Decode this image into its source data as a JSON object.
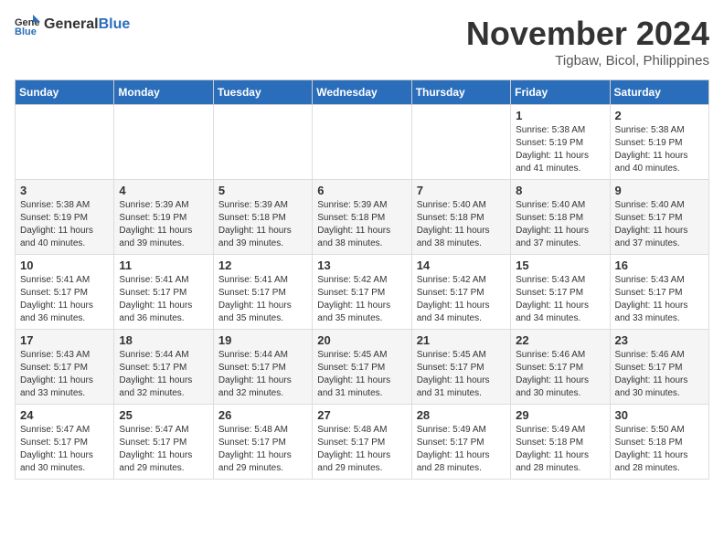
{
  "header": {
    "logo_general": "General",
    "logo_blue": "Blue",
    "month": "November 2024",
    "location": "Tigbaw, Bicol, Philippines"
  },
  "weekdays": [
    "Sunday",
    "Monday",
    "Tuesday",
    "Wednesday",
    "Thursday",
    "Friday",
    "Saturday"
  ],
  "weeks": [
    [
      {
        "day": "",
        "info": ""
      },
      {
        "day": "",
        "info": ""
      },
      {
        "day": "",
        "info": ""
      },
      {
        "day": "",
        "info": ""
      },
      {
        "day": "",
        "info": ""
      },
      {
        "day": "1",
        "info": "Sunrise: 5:38 AM\nSunset: 5:19 PM\nDaylight: 11 hours\nand 41 minutes."
      },
      {
        "day": "2",
        "info": "Sunrise: 5:38 AM\nSunset: 5:19 PM\nDaylight: 11 hours\nand 40 minutes."
      }
    ],
    [
      {
        "day": "3",
        "info": "Sunrise: 5:38 AM\nSunset: 5:19 PM\nDaylight: 11 hours\nand 40 minutes."
      },
      {
        "day": "4",
        "info": "Sunrise: 5:39 AM\nSunset: 5:19 PM\nDaylight: 11 hours\nand 39 minutes."
      },
      {
        "day": "5",
        "info": "Sunrise: 5:39 AM\nSunset: 5:18 PM\nDaylight: 11 hours\nand 39 minutes."
      },
      {
        "day": "6",
        "info": "Sunrise: 5:39 AM\nSunset: 5:18 PM\nDaylight: 11 hours\nand 38 minutes."
      },
      {
        "day": "7",
        "info": "Sunrise: 5:40 AM\nSunset: 5:18 PM\nDaylight: 11 hours\nand 38 minutes."
      },
      {
        "day": "8",
        "info": "Sunrise: 5:40 AM\nSunset: 5:18 PM\nDaylight: 11 hours\nand 37 minutes."
      },
      {
        "day": "9",
        "info": "Sunrise: 5:40 AM\nSunset: 5:17 PM\nDaylight: 11 hours\nand 37 minutes."
      }
    ],
    [
      {
        "day": "10",
        "info": "Sunrise: 5:41 AM\nSunset: 5:17 PM\nDaylight: 11 hours\nand 36 minutes."
      },
      {
        "day": "11",
        "info": "Sunrise: 5:41 AM\nSunset: 5:17 PM\nDaylight: 11 hours\nand 36 minutes."
      },
      {
        "day": "12",
        "info": "Sunrise: 5:41 AM\nSunset: 5:17 PM\nDaylight: 11 hours\nand 35 minutes."
      },
      {
        "day": "13",
        "info": "Sunrise: 5:42 AM\nSunset: 5:17 PM\nDaylight: 11 hours\nand 35 minutes."
      },
      {
        "day": "14",
        "info": "Sunrise: 5:42 AM\nSunset: 5:17 PM\nDaylight: 11 hours\nand 34 minutes."
      },
      {
        "day": "15",
        "info": "Sunrise: 5:43 AM\nSunset: 5:17 PM\nDaylight: 11 hours\nand 34 minutes."
      },
      {
        "day": "16",
        "info": "Sunrise: 5:43 AM\nSunset: 5:17 PM\nDaylight: 11 hours\nand 33 minutes."
      }
    ],
    [
      {
        "day": "17",
        "info": "Sunrise: 5:43 AM\nSunset: 5:17 PM\nDaylight: 11 hours\nand 33 minutes."
      },
      {
        "day": "18",
        "info": "Sunrise: 5:44 AM\nSunset: 5:17 PM\nDaylight: 11 hours\nand 32 minutes."
      },
      {
        "day": "19",
        "info": "Sunrise: 5:44 AM\nSunset: 5:17 PM\nDaylight: 11 hours\nand 32 minutes."
      },
      {
        "day": "20",
        "info": "Sunrise: 5:45 AM\nSunset: 5:17 PM\nDaylight: 11 hours\nand 31 minutes."
      },
      {
        "day": "21",
        "info": "Sunrise: 5:45 AM\nSunset: 5:17 PM\nDaylight: 11 hours\nand 31 minutes."
      },
      {
        "day": "22",
        "info": "Sunrise: 5:46 AM\nSunset: 5:17 PM\nDaylight: 11 hours\nand 30 minutes."
      },
      {
        "day": "23",
        "info": "Sunrise: 5:46 AM\nSunset: 5:17 PM\nDaylight: 11 hours\nand 30 minutes."
      }
    ],
    [
      {
        "day": "24",
        "info": "Sunrise: 5:47 AM\nSunset: 5:17 PM\nDaylight: 11 hours\nand 30 minutes."
      },
      {
        "day": "25",
        "info": "Sunrise: 5:47 AM\nSunset: 5:17 PM\nDaylight: 11 hours\nand 29 minutes."
      },
      {
        "day": "26",
        "info": "Sunrise: 5:48 AM\nSunset: 5:17 PM\nDaylight: 11 hours\nand 29 minutes."
      },
      {
        "day": "27",
        "info": "Sunrise: 5:48 AM\nSunset: 5:17 PM\nDaylight: 11 hours\nand 29 minutes."
      },
      {
        "day": "28",
        "info": "Sunrise: 5:49 AM\nSunset: 5:17 PM\nDaylight: 11 hours\nand 28 minutes."
      },
      {
        "day": "29",
        "info": "Sunrise: 5:49 AM\nSunset: 5:18 PM\nDaylight: 11 hours\nand 28 minutes."
      },
      {
        "day": "30",
        "info": "Sunrise: 5:50 AM\nSunset: 5:18 PM\nDaylight: 11 hours\nand 28 minutes."
      }
    ]
  ]
}
